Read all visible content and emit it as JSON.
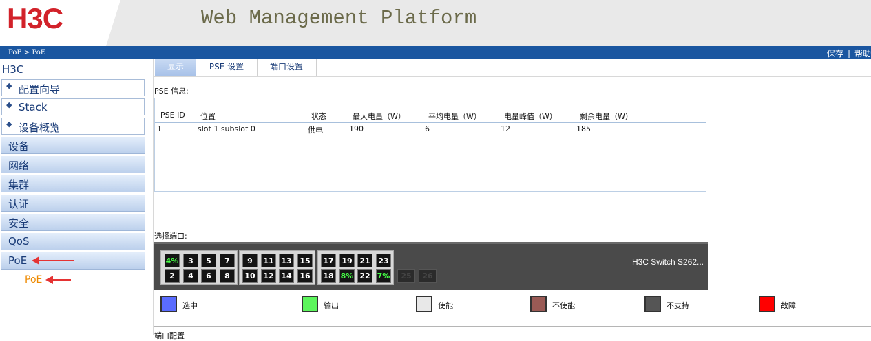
{
  "header": {
    "logo": "H3C",
    "title": "Web Management Platform"
  },
  "topbar": {
    "breadcrumb": "PoE > PoE",
    "save": "保存",
    "separator": "|",
    "help": "帮助"
  },
  "sidebar": {
    "root": "H3C",
    "top_items": [
      "配置向导",
      "Stack",
      "设备概览"
    ],
    "categories": [
      "设备",
      "网络",
      "集群",
      "认证",
      "安全",
      "QoS",
      "PoE"
    ],
    "sub_item": "PoE",
    "arrow_color": "#e53333"
  },
  "tabs": [
    "显示",
    "PSE 设置",
    "端口设置"
  ],
  "pse": {
    "title": "PSE 信息:",
    "columns": [
      "PSE ID",
      "位置",
      "状态",
      "最大电量（W）",
      "平均电量（W）",
      "电量峰值（W）",
      "剩余电量（W）"
    ],
    "row": [
      "1",
      "slot 1 subslot 0",
      "供电",
      "190",
      "6",
      "12",
      "185"
    ]
  },
  "ports": {
    "title": "选择端口:",
    "top_row": [
      "4%",
      "3",
      "5",
      "7",
      "9",
      "11",
      "13",
      "15",
      "17",
      "19",
      "21",
      "23"
    ],
    "bottom_row": [
      "2",
      "4",
      "6",
      "8",
      "10",
      "12",
      "14",
      "16",
      "18",
      "8%",
      "22",
      "7%"
    ],
    "extra": [
      "25",
      "26"
    ],
    "switch_label": "H3C Switch S262..."
  },
  "legend": [
    {
      "label": "选中",
      "color": "#5a6cff"
    },
    {
      "label": "输出",
      "color": "#5cf55c"
    },
    {
      "label": "使能",
      "color": "#e8e8e8"
    },
    {
      "label": "不使能",
      "color": "#9a5a55"
    },
    {
      "label": "不支持",
      "color": "#555555"
    },
    {
      "label": "故障",
      "color": "#ff0000"
    }
  ],
  "footer_partial": "端口配置"
}
